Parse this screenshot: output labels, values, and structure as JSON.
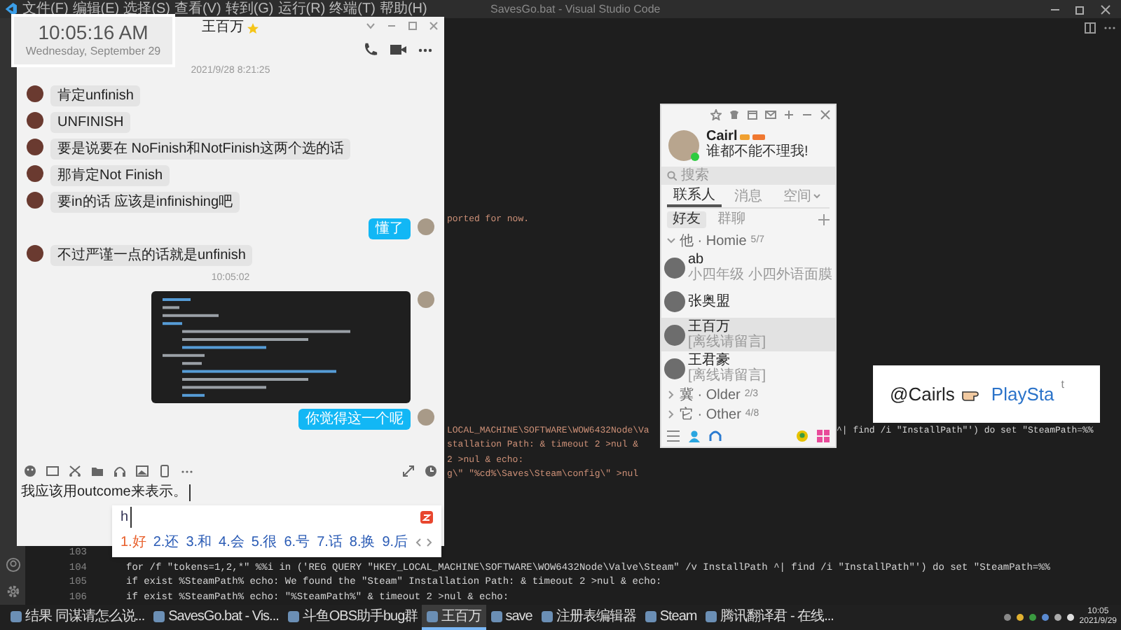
{
  "vscode": {
    "menu": [
      "文件(F)",
      "编辑(E)",
      "选择(S)",
      "查看(V)",
      "转到(G)",
      "运行(R)",
      "终端(T)",
      "帮助(H)"
    ],
    "title": "SavesGo.bat - Visual Studio Code",
    "fragment_groups": [
      [
        {
          "segments": [
            "ported for now."
          ]
        }
      ],
      [
        {
          "segments": [
            "LOCAL_MACHINE\\SOFTWARE\\WOW6432Node\\Va",
            "^| find /i \"InstallPath\"') do set \"SteamPath=%%"
          ]
        },
        {
          "segments": [
            "stallation Path: & timeout 2 >nul &"
          ]
        },
        {
          "segments": [
            "2 >nul & echo:"
          ]
        },
        {
          "segments": [
            "g\\\" \"%cd%\\Saves\\Steam\\config\\\" >nul"
          ]
        }
      ]
    ],
    "lines": [
      {
        "number": "103"
      },
      {
        "number": "104",
        "text": "for /f \"tokens=1,2,*\" %%i in ('REG QUERY \"HKEY_LOCAL_MACHINE\\SOFTWARE\\WOW6432Node\\Valve\\Steam\" /v InstallPath ^| find /i \"InstallPath\"') do set \"SteamPath=%%"
      },
      {
        "number": "105",
        "text": "if exist %SteamPath% echo: We found the \"Steam\" Installation Path: & timeout 2 >nul & echo:"
      },
      {
        "number": "106",
        "text": "if exist %SteamPath% echo: \"%SteamPath%\" & timeout 2 >nul & echo:"
      }
    ]
  },
  "clock": {
    "time": "10:05:16 AM",
    "date": "Wednesday, September 29"
  },
  "chat": {
    "title": "王百万",
    "starred": true,
    "messages": [
      {
        "kind": "timestamp",
        "text": "2021/9/28 8:21:25"
      },
      {
        "kind": "incoming",
        "text": "肯定unfinish"
      },
      {
        "kind": "incoming",
        "text": "UNFINISH"
      },
      {
        "kind": "incoming",
        "text": "要是说要在 NoFinish和NotFinish这两个选的话"
      },
      {
        "kind": "incoming",
        "text": "那肯定Not Finish"
      },
      {
        "kind": "incoming",
        "text": "要in的话 应该是infinishing吧"
      },
      {
        "kind": "outgoing",
        "text": "懂了"
      },
      {
        "kind": "incoming",
        "text": "不过严谨一点的话就是unfinish"
      },
      {
        "kind": "timestamp",
        "text": "10:05:02"
      },
      {
        "kind": "image"
      },
      {
        "kind": "outgoing",
        "text": "你觉得这一个呢"
      }
    ],
    "input_text": "我应该用outcome来表示。"
  },
  "ime": {
    "input": "h",
    "candidates": [
      "1.好",
      "2.还",
      "3.和",
      "4.会",
      "5.很",
      "6.号",
      "7.话",
      "8.换",
      "9.后"
    ]
  },
  "contacts": {
    "name": "Cairl",
    "signature": "谁都不能不理我!",
    "online": true,
    "search_placeholder": "搜索",
    "tabs": [
      {
        "label": "联系人",
        "selected": true
      },
      {
        "label": "消息",
        "selected": false
      },
      {
        "label": "空间",
        "selected": false
      }
    ],
    "subtabs": [
      {
        "label": "好友",
        "selected": true
      },
      {
        "label": "群聊",
        "selected": false
      }
    ],
    "groups": [
      {
        "label": "他 · Homie",
        "count": "5/7",
        "expanded": true,
        "children": [
          {
            "name": "ab",
            "status": "小四年级 小四外语面膜",
            "selected": false
          },
          {
            "name": "张奥盟",
            "selected": false
          },
          {
            "name": "王百万",
            "status": "[离线请留言]",
            "selected": true
          },
          {
            "name": "王君豪",
            "status": "[离线请留言]",
            "selected": false
          }
        ]
      },
      {
        "label": "冀 · Older",
        "count": "2/3",
        "expanded": false
      },
      {
        "label": "它 · Other",
        "count": "4/8",
        "expanded": false
      }
    ]
  },
  "overlay": {
    "handle": "@Cairls",
    "text": "PlaySta",
    "mark": "t"
  },
  "taskbar": {
    "items": [
      {
        "label": "结果 同谋请怎么说...",
        "selected": false
      },
      {
        "label": "SavesGo.bat - Vis...",
        "selected": false
      },
      {
        "label": "斗鱼OBS助手bug群",
        "selected": false
      },
      {
        "label": "王百万",
        "selected": true
      },
      {
        "label": "save",
        "selected": false
      },
      {
        "label": "注册表编辑器",
        "selected": false
      },
      {
        "label": "Steam",
        "selected": false
      },
      {
        "label": "腾讯翻译君 - 在线...",
        "selected": false
      }
    ],
    "time": "10:05",
    "date": "2021/9/29"
  }
}
